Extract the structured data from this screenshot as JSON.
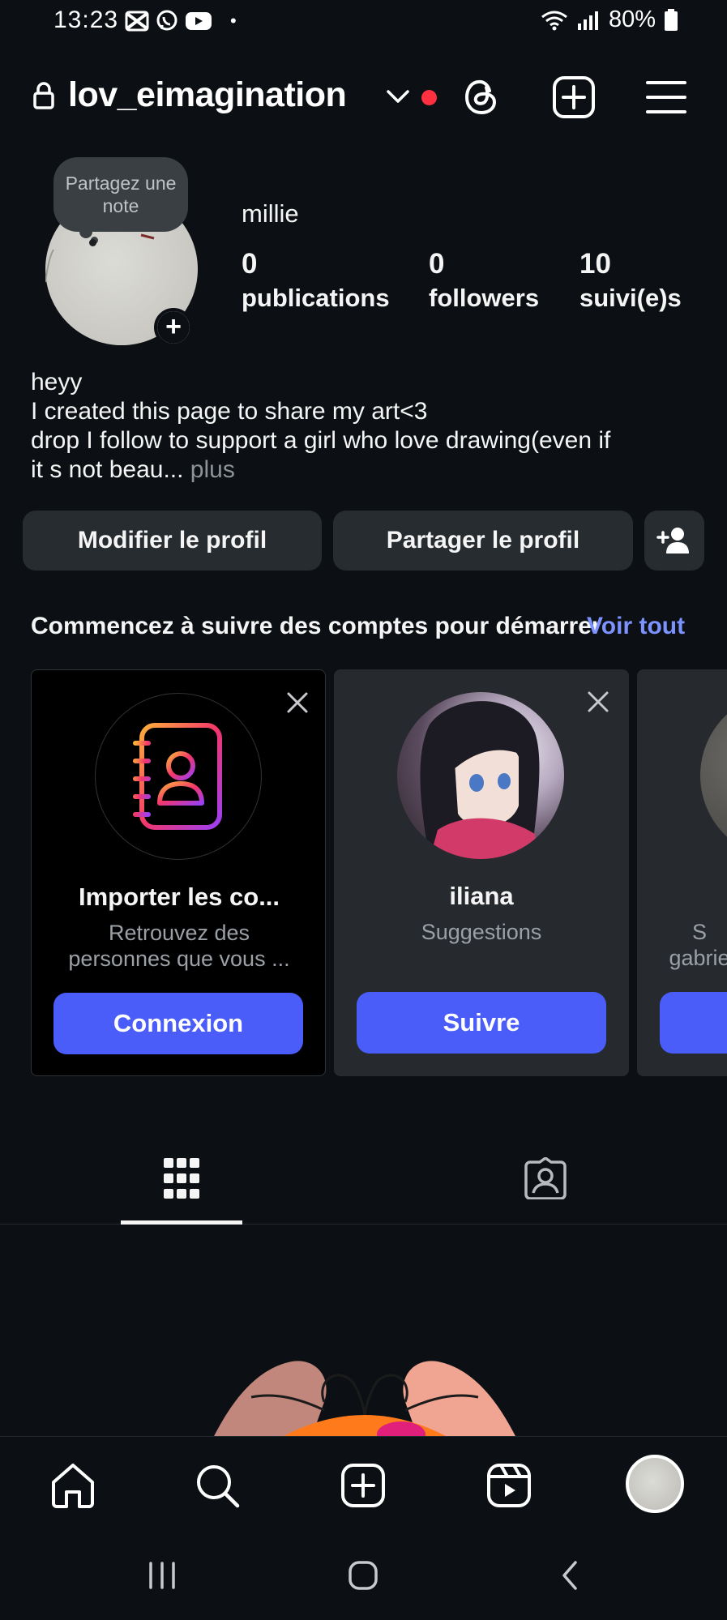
{
  "status_bar": {
    "time": "13:23",
    "battery": "80%",
    "dot": "•"
  },
  "header": {
    "username": "lov_eimagination",
    "notification_color": "#ff3040"
  },
  "profile": {
    "note_bubble": "Partagez une note",
    "display_name": "millie",
    "stats": [
      {
        "value": "0",
        "label": "publications"
      },
      {
        "value": "0",
        "label": "followers"
      },
      {
        "value": "10",
        "label": "suivi(e)s"
      }
    ],
    "bio_lines": [
      "heyy",
      "I created this page to share my art<3",
      "drop I follow to support a girl who love drawing(even if",
      "it s not beau..."
    ],
    "bio_more": " plus"
  },
  "actions": {
    "edit_label": "Modifier le profil",
    "share_label": "Partager le profil"
  },
  "suggestions": {
    "title": "Commencez à suivre des comptes pour démarrer",
    "see_all": "Voir tout",
    "cards": [
      {
        "name": "Importer les co...",
        "subtitle_1": "Retrouvez des",
        "subtitle_2": "personnes que vous ...",
        "button": "Connexion"
      },
      {
        "name": "iliana",
        "subtitle_1": "Suggestions",
        "subtitle_2": "",
        "button": "Suivre"
      },
      {
        "name": "",
        "subtitle_1": "S",
        "subtitle_2": "gabrie",
        "button": ""
      }
    ]
  },
  "tabs": [
    {
      "icon": "grid-icon",
      "active": true
    },
    {
      "icon": "tagged-icon",
      "active": false
    }
  ],
  "bottom_nav": [
    {
      "icon": "home-icon"
    },
    {
      "icon": "search-icon"
    },
    {
      "icon": "create-icon"
    },
    {
      "icon": "reels-icon"
    },
    {
      "icon": "profile-avatar"
    }
  ],
  "colors": {
    "background": "#0c1014",
    "button_bg": "#262c2f",
    "accent": "#4a5df9",
    "link": "#7c92ff"
  }
}
